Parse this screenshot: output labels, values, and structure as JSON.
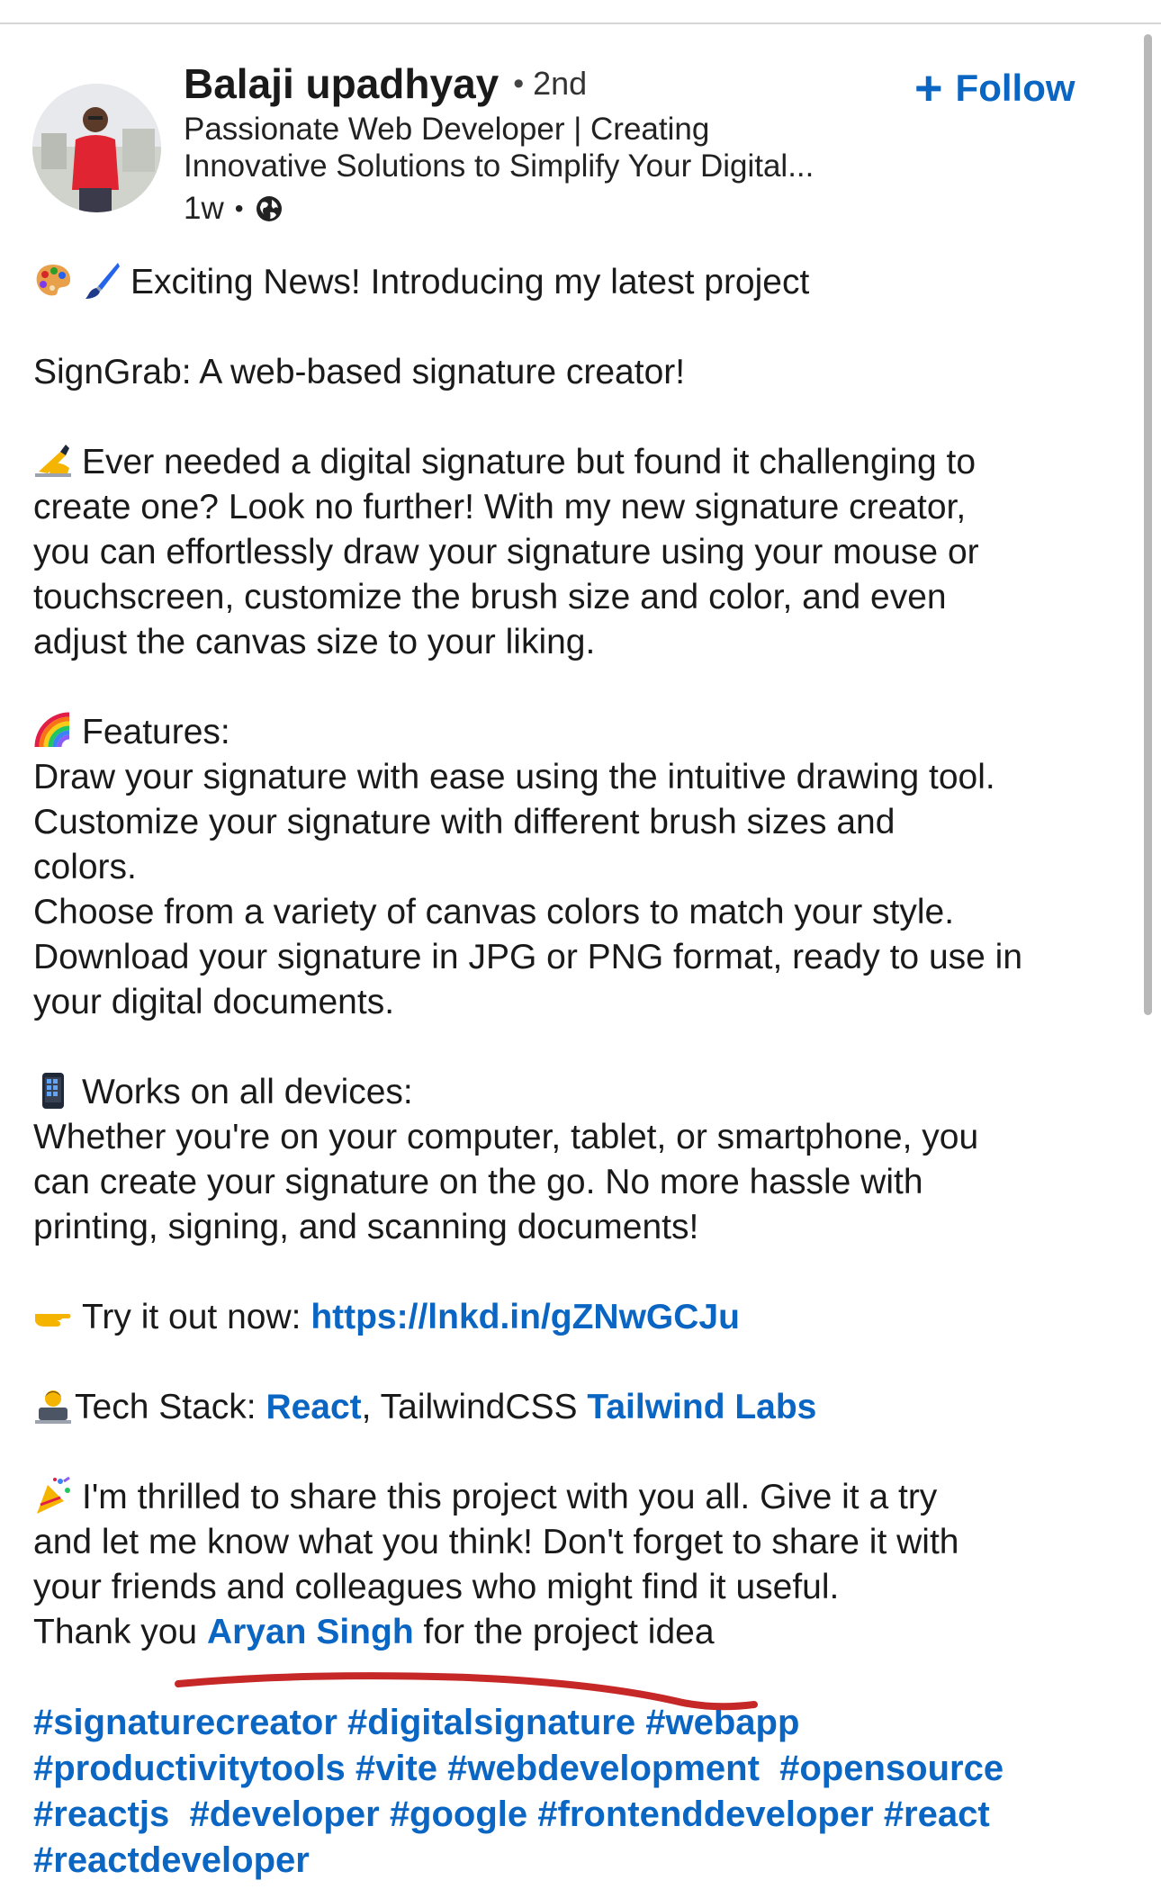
{
  "author": {
    "name": "Balaji upadhyay",
    "degree": "2nd",
    "headline_line1": "Passionate Web Developer | Creating",
    "headline_line2": "Innovative Solutions to Simplify Your Digital...",
    "time": "1w"
  },
  "follow_label": "Follow",
  "post": {
    "intro": "Exciting News! Introducing my latest project",
    "title": "SignGrab: A web-based signature creator!",
    "p1_l1": "Ever needed a digital signature but found it challenging to",
    "p1_l2": "create one? Look no further! With my new signature creator,",
    "p1_l3": "you can effortlessly draw your signature using your mouse or",
    "p1_l4": "touchscreen, customize the brush size and color, and even",
    "p1_l5": "adjust the canvas size to your liking.",
    "features_title": "Features:",
    "f_l1": "Draw your signature with ease using the intuitive drawing tool.",
    "f_l2": "Customize your signature with different brush sizes and",
    "f_l3": "colors.",
    "f_l4": "Choose from a variety of canvas colors to match your style.",
    "f_l5": "Download your signature in JPG or PNG format, ready to use in",
    "f_l6": "your digital documents.",
    "devices_title": "Works on all devices:",
    "d_l1": "Whether you're on your computer, tablet, or smartphone, you",
    "d_l2": "can create your signature on the go. No more hassle with",
    "d_l3": "printing, signing, and scanning documents!",
    "try_text": "Try it out now:",
    "try_link": "https://lnkd.in/gZNwGCJu",
    "stack_text": "Tech Stack:",
    "stack_react": "React",
    "stack_comma_tailwind": ", TailwindCSS",
    "stack_tailwind_labs": "Tailwind Labs",
    "c_l1": "I'm thrilled to share this project with you all. Give it a try",
    "c_l2": "and let me know what you think! Don't forget to share it with",
    "c_l3": "your friends and colleagues who might find it useful.",
    "thanks_pre": "Thank you",
    "thanks_name": "Aryan Singh",
    "thanks_post": "for the project idea"
  },
  "hashtags": {
    "line1": [
      "#signaturecreator",
      "#digitalsignature",
      "#webapp"
    ],
    "line2": [
      "#productivitytools",
      "#vite",
      "#webdevelopment",
      "#opensource"
    ],
    "line3": [
      "#reactjs",
      "#developer",
      "#google",
      "#frontenddeveloper",
      "#react"
    ],
    "line4": [
      "#reactdeveloper"
    ]
  },
  "icons": [
    "globe-icon",
    "palette-icon",
    "paintbrush-icon",
    "writing-hand-icon",
    "rainbow-icon",
    "mobile-phone-icon",
    "pointing-hand-icon",
    "technologist-icon",
    "party-popper-icon",
    "plus-icon"
  ],
  "colors": {
    "link": "#0a66c2",
    "text": "#1a1a1a",
    "annotation": "#c62828"
  }
}
